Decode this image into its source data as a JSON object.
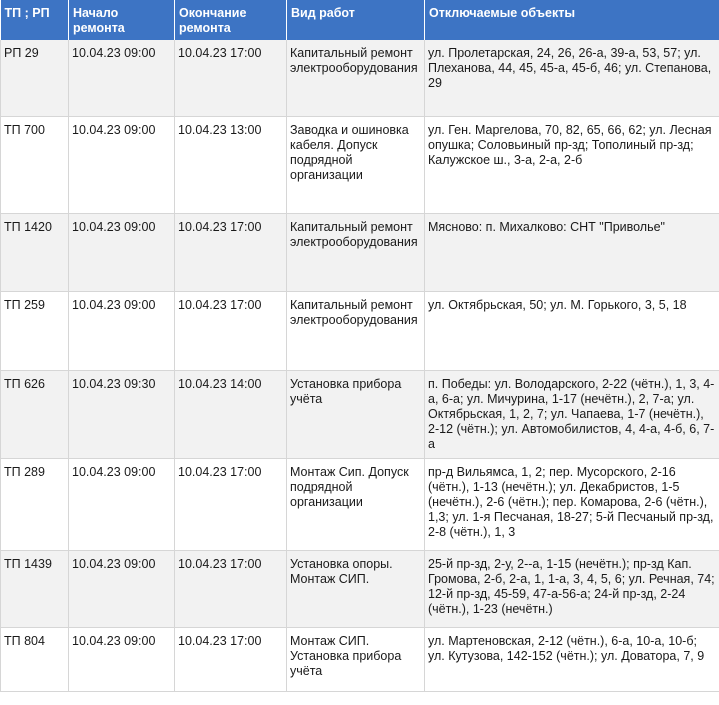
{
  "table": {
    "headers": [
      "ТП ; РП",
      "Начало ремонта",
      "Окончание ремонта",
      "Вид работ",
      "Отключаемые объекты"
    ],
    "rows": [
      {
        "station": "РП 29",
        "start": "10.04.23 09:00",
        "end": "10.04.23 17:00",
        "work": "Капитальный ремонт электрооборудования",
        "objects": "ул. Пролетарская, 24, 26, 26-а, 39-а, 53, 57; ул. Плеханова, 44, 45, 45-а, 45-б, 46; ул. Степанова, 29"
      },
      {
        "station": "ТП 700",
        "start": "10.04.23 09:00",
        "end": "10.04.23 13:00",
        "work": "Заводка и ошиновка кабеля. Допуск подрядной организации",
        "objects": "ул. Ген. Маргелова, 70, 82, 65, 66, 62; ул. Лесная опушка; Соловьиный пр-зд; Тополиный пр-зд; Калужское ш., 3-а, 2-а, 2-б"
      },
      {
        "station": "ТП 1420",
        "start": "10.04.23 09:00",
        "end": "10.04.23 17:00",
        "work": "Капитальный ремонт электрооборудования",
        "objects": "Мясново: п. Михалково: СНТ \"Приволье\""
      },
      {
        "station": "ТП 259",
        "start": "10.04.23 09:00",
        "end": "10.04.23 17:00",
        "work": "Капитальный ремонт электрооборудования",
        "objects": "ул. Октябрьская, 50; ул. М. Горького, 3, 5, 18"
      },
      {
        "station": "ТП 626",
        "start": "10.04.23 09:30",
        "end": "10.04.23 14:00",
        "work": "Установка прибора учёта",
        "objects": "п. Победы: ул. Володарского, 2-22 (чётн.), 1, 3, 4-а, 6-а; ул. Мичурина, 1-17 (нечётн.), 2, 7-а; ул. Октябрьская, 1, 2, 7; ул. Чапаева, 1-7 (нечётн.), 2-12 (чётн.); ул. Автомобилистов, 4, 4-а, 4-б, 6, 7-а"
      },
      {
        "station": "ТП 289",
        "start": "10.04.23 09:00",
        "end": "10.04.23 17:00",
        "work": "Монтаж Сип. Допуск подрядной организации",
        "objects": "пр-д Вильямса, 1, 2; пер. Мусорского, 2-16 (чётн.), 1-13 (нечётн.); ул. Декабристов, 1-5 (нечётн.), 2-6 (чётн.); пер. Комарова, 2-6 (чётн.), 1,3; ул. 1-я Песчаная, 18-27; 5-й Песчаный пр-зд, 2-8 (чётн.), 1, 3"
      },
      {
        "station": "ТП 1439",
        "start": "10.04.23 09:00",
        "end": "10.04.23 17:00",
        "work": "Установка опоры. Монтаж СИП.",
        "objects": "25-й пр-зд, 2-у, 2--а, 1-15 (нечётн.); пр-зд Кап. Громова, 2-б, 2-а, 1, 1-а, 3, 4, 5, 6; ул. Речная, 74; 12-й пр-зд, 45-59, 47-а-56-а; 24-й пр-зд, 2-24 (чётн.), 1-23 (нечётн.)"
      },
      {
        "station": "ТП 804",
        "start": "10.04.23 09:00",
        "end": "10.04.23 17:00",
        "work": "Монтаж СИП. Установка прибора учёта",
        "objects": "ул. Мартеновская, 2-12 (чётн.), 6-а, 10-а, 10-б; ул. Кутузова, 142-152 (чётн.); ул. Доватора, 7, 9"
      }
    ]
  }
}
